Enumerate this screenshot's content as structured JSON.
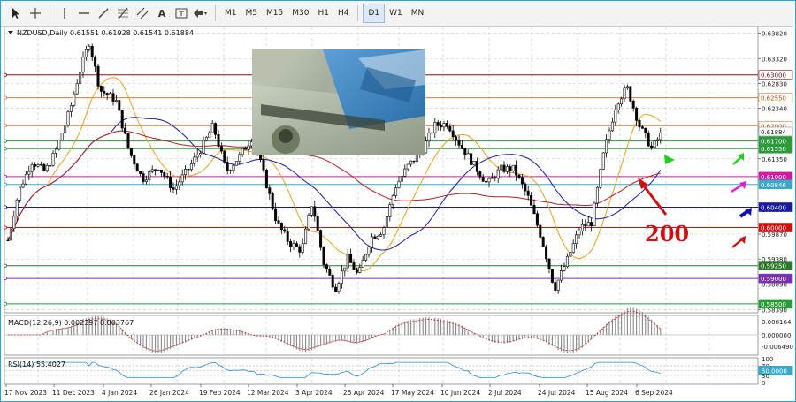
{
  "toolbar": {
    "tools": [
      {
        "name": "cursor-tool-icon"
      },
      {
        "name": "crosshair-tool-icon"
      },
      {
        "name": "vertical-line-tool-icon"
      },
      {
        "name": "horizontal-line-tool-icon"
      },
      {
        "name": "trend-line-tool-icon"
      },
      {
        "name": "fibonacci-tool-icon"
      },
      {
        "name": "equidistant-channel-tool-icon"
      },
      {
        "name": "text-tool-icon",
        "text": "A"
      },
      {
        "name": "text-label-tool-icon"
      },
      {
        "name": "arrows-tool-icon"
      }
    ],
    "timeframes": [
      "M1",
      "M5",
      "M15",
      "M30",
      "H1",
      "H4",
      "D1",
      "W1",
      "MN"
    ],
    "active_timeframe": "D1"
  },
  "chart": {
    "header": "NZDUSD,Daily  0.61551 0.61928 0.61541 0.61884",
    "price_ticks": [
      "0.63820",
      "0.63320",
      "0.62830",
      "0.62340",
      "0.61350",
      "0.60360",
      "0.59870",
      "0.59380",
      "0.58890",
      "0.58390"
    ],
    "price_labels": [
      {
        "text": "0.63000",
        "price": 0.63,
        "bg": "#ffffff",
        "fg": "#6b1010",
        "line": "#7a1515"
      },
      {
        "text": "0.62550",
        "price": 0.6255,
        "bg": "#ffffff",
        "fg": "#a8501a",
        "line": "#d08040"
      },
      {
        "text": "0.62000",
        "price": 0.62,
        "bg": "#ffffff",
        "fg": "#a8501a",
        "line": "#d08040"
      },
      {
        "text": "0.61884",
        "price": 0.61884,
        "bg": "#ffffff",
        "fg": "#222222",
        "line": ""
      },
      {
        "text": "0.61700",
        "price": 0.617,
        "bg": "#2a9a3a",
        "fg": "#ffffff",
        "line": "#2a9a3a"
      },
      {
        "text": "0.61550",
        "price": 0.6155,
        "bg": "#2a9a3a",
        "fg": "#ffffff",
        "line": "#2a9a3a"
      },
      {
        "text": "0.61000",
        "price": 0.61,
        "bg": "#d01aa0",
        "fg": "#ffffff",
        "line": "#d01aa0"
      },
      {
        "text": "0.60846",
        "price": 0.60846,
        "bg": "#3aa8c8",
        "fg": "#ffffff",
        "line": "#3aa8c8"
      },
      {
        "text": "0.60400",
        "price": 0.604,
        "bg": "#1a1aa0",
        "fg": "#ffffff",
        "line": "#1a1aa0"
      },
      {
        "text": "0.60000",
        "price": 0.6,
        "bg": "#d01010",
        "fg": "#ffffff",
        "line": "#d01010"
      },
      {
        "text": "0.59250",
        "price": 0.5925,
        "bg": "#2a7a2a",
        "fg": "#ffffff",
        "line": "#2a7a2a"
      },
      {
        "text": "0.59000",
        "price": 0.59,
        "bg": "#7a30b0",
        "fg": "#ffffff",
        "line": "#7a30b0"
      },
      {
        "text": "0.58500",
        "price": 0.585,
        "bg": "#2a9a3a",
        "fg": "#ffffff",
        "line": "#2a9a3a"
      }
    ],
    "annotation_text": "200",
    "macd": {
      "label": "MACD(12,26,9) 0.002397 0.003767",
      "ticks": [
        "0.008164",
        "0.000000",
        "-0.006490"
      ]
    },
    "rsi": {
      "label": "RSI(14) 55.4027",
      "ticks": [
        "100",
        "70",
        "50.0000",
        "30",
        "0"
      ]
    },
    "dates": [
      "17 Nov 2023",
      "11 Dec 2023",
      "4 Jan 2024",
      "26 Jan 2024",
      "19 Feb 2024",
      "12 Mar 2024",
      "3 Apr 2024",
      "25 Apr 2024",
      "17 May 2024",
      "10 Jun 2024",
      "2 Jul 2024",
      "24 Jul 2024",
      "15 Aug 2024",
      "6 Sep 2024"
    ],
    "colors": {
      "candle": "#000000",
      "ma_short": "#e8a020",
      "ma_mid": "#1a1a9a",
      "ma_long": "#b02020",
      "grid": "#c0c0c0"
    }
  }
}
